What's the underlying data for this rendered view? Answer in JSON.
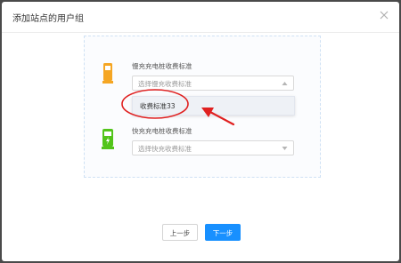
{
  "dialog": {
    "title": "添加站点的用户组"
  },
  "slow": {
    "icon": "slow-charger-icon",
    "label": "慢充充电桩收费标准",
    "placeholder": "选择慢充收费标准",
    "dropdown_options": [
      "收费标准33"
    ]
  },
  "fast": {
    "icon": "fast-charger-icon",
    "label": "快充充电桩收费标准",
    "placeholder": "选择快充收费标准"
  },
  "footer": {
    "prev_label": "上一步",
    "next_label": "下一步"
  },
  "colors": {
    "primary": "#1890ff",
    "slow_icon": "#f5a623",
    "fast_icon": "#52c41a",
    "annotation": "#e02020"
  }
}
